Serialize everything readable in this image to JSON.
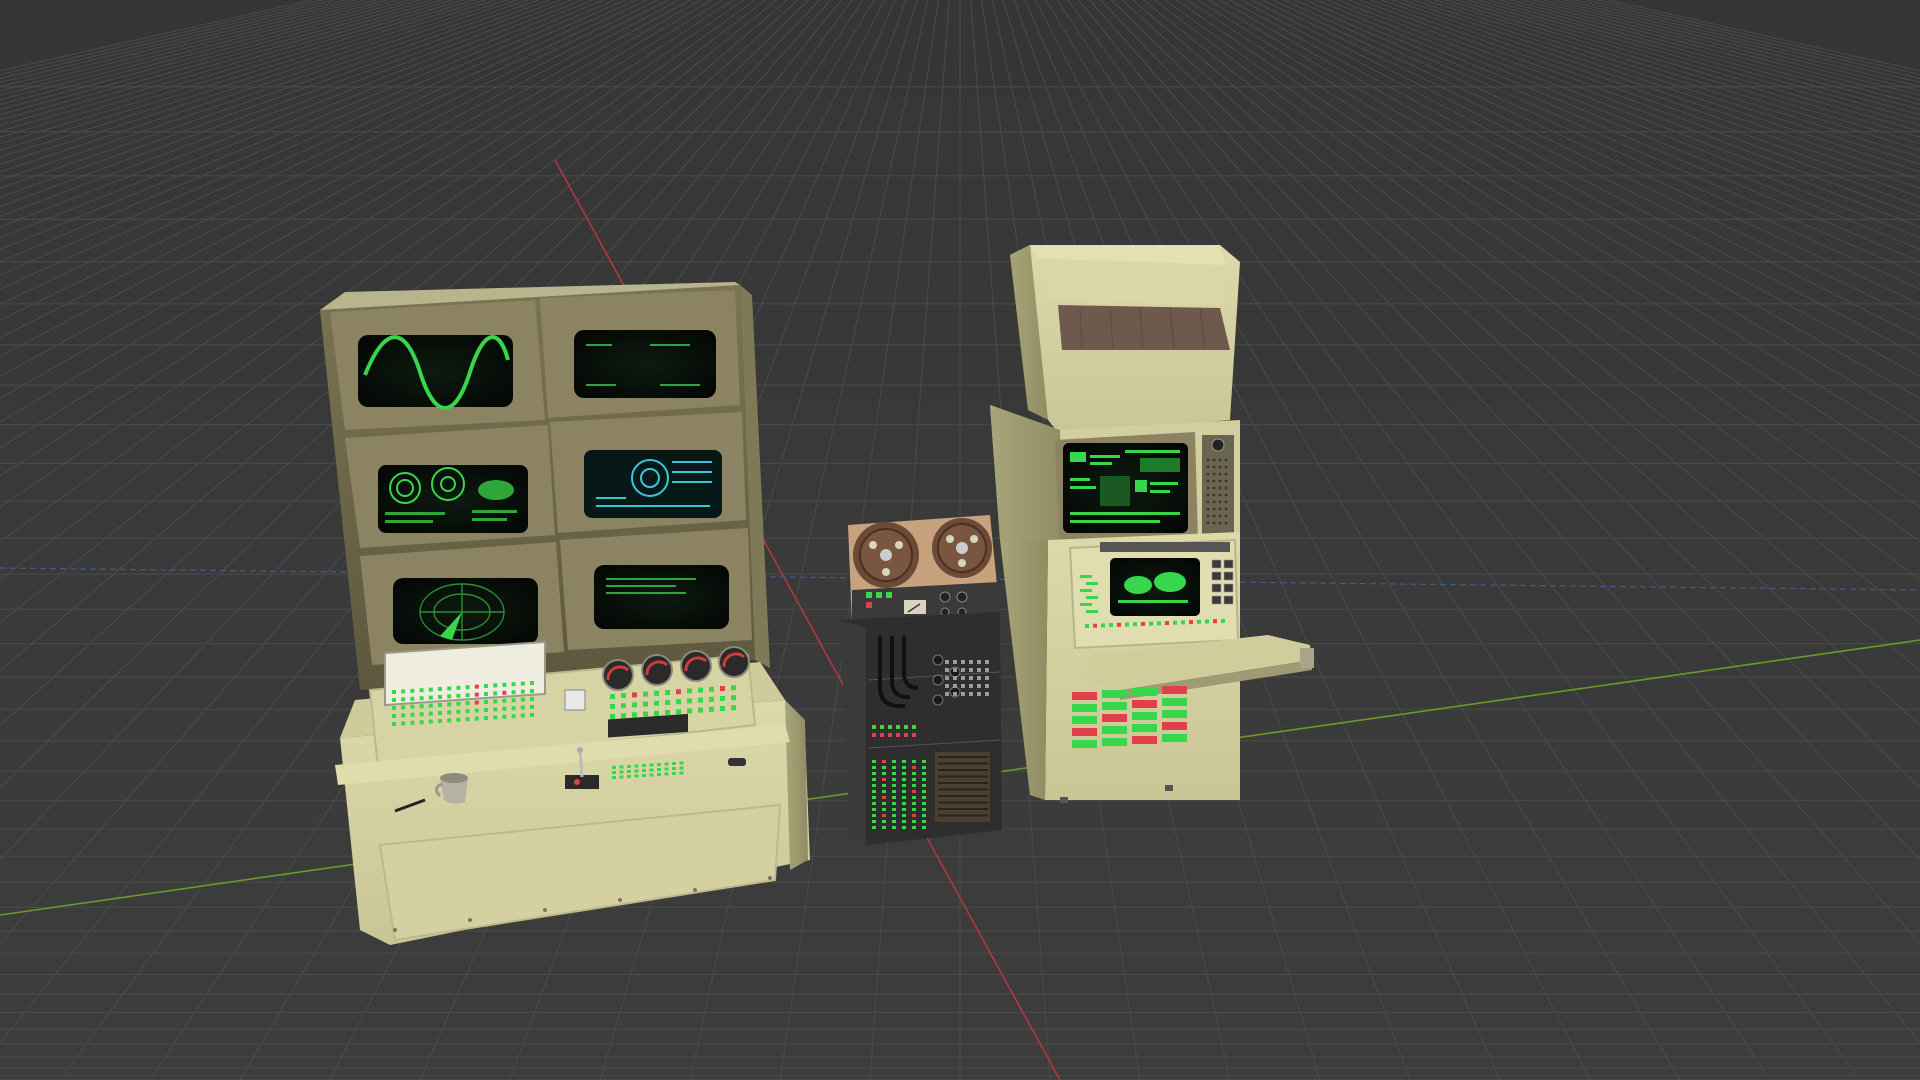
{
  "viewport": {
    "mode": "3d-viewport",
    "background": "#393939",
    "grid_color": "#4a4a4a",
    "x_axis_color": "#b2383e",
    "y_axis_color": "#6a9a2a"
  },
  "scene": {
    "objects": [
      {
        "name": "control-console",
        "color": "#d9d6a6"
      },
      {
        "name": "tape-reel-rack",
        "color": "#2c2c2c"
      },
      {
        "name": "terminal-cabinet",
        "color": "#cfc89a"
      }
    ],
    "screen_color": "#38d64a",
    "indicator_red": "#e0404a"
  }
}
